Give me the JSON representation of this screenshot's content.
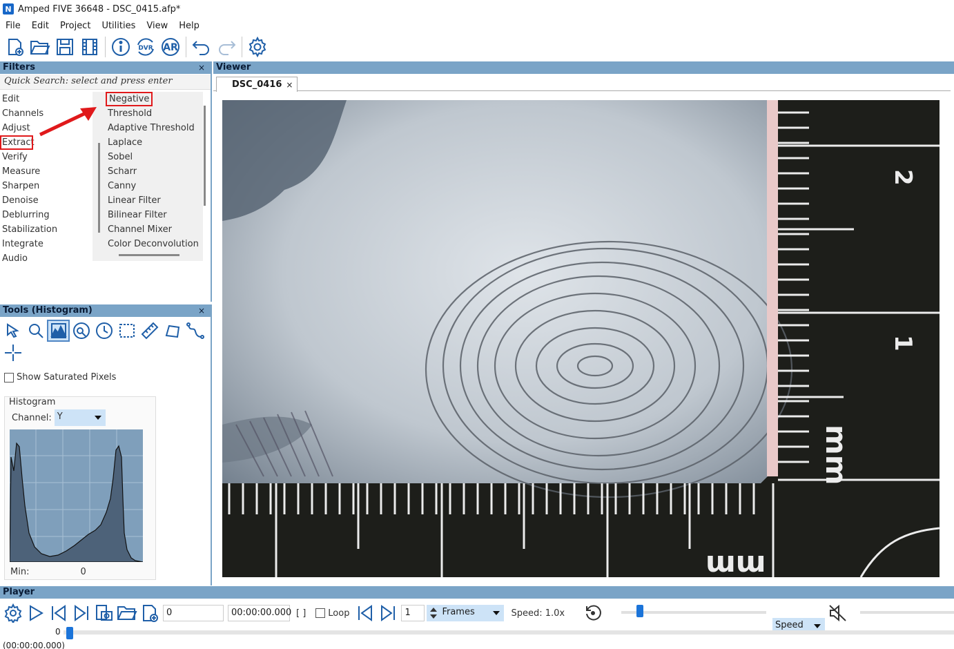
{
  "window": {
    "title": "Amped FIVE 36648 - DSC_0415.afp*",
    "app_icon_text": "N"
  },
  "menu": [
    "File",
    "Edit",
    "Project",
    "Utilities",
    "View",
    "Help"
  ],
  "toolbar": {
    "icons": [
      "new-project-icon",
      "open-folder-icon",
      "save-icon",
      "film-icon",
      "info-icon",
      "dvr-icon",
      "ar-icon",
      "undo-icon",
      "redo-icon",
      "settings-gear-icon"
    ],
    "dvr_text": "DVR",
    "ar_text": "AR"
  },
  "filters": {
    "title": "Filters",
    "close": "×",
    "search_placeholder": "Quick Search: select and press enter",
    "categories": [
      "Edit",
      "Channels",
      "Adjust",
      "Extract",
      "Verify",
      "Measure",
      "Sharpen",
      "Denoise",
      "Deblurring",
      "Stabilization",
      "Integrate",
      "Audio"
    ],
    "selected_category": "Extract",
    "items": [
      "Negative",
      "Threshold",
      "Adaptive Threshold",
      "Laplace",
      "Sobel",
      "Scharr",
      "Canny",
      "Linear Filter",
      "Bilinear Filter",
      "Channel Mixer",
      "Color Deconvolution"
    ],
    "selected_item": "Negative"
  },
  "tools": {
    "title": "Tools (Histogram)",
    "close": "×",
    "icons": [
      "select-arrow-icon",
      "zoom-icon",
      "histogram-icon",
      "magnifier-circle-icon",
      "clock-icon",
      "rectangle-select-icon",
      "ruler-icon",
      "polygon-icon",
      "curve-icon",
      "crosshair-icon"
    ],
    "show_saturated_label": "Show Saturated Pixels",
    "histogram_label": "Histogram",
    "channel_label": "Channel:",
    "channel_value": "Y",
    "min_label": "Min:",
    "min_value": "0"
  },
  "viewer": {
    "title": "Viewer",
    "tab_label": "DSC_0416",
    "tab_close": "×",
    "ruler_right_labels": [
      "2",
      "1",
      "mm"
    ],
    "ruler_bottom_label": "mm"
  },
  "player": {
    "title": "Player",
    "frame_field": "0",
    "time_field": "00:00:00.000",
    "brackets": "[ ]",
    "loop_label": "Loop",
    "step_field": "1",
    "unit_select": "Frames",
    "speed_label": "Speed: 1.0x",
    "speed_select": "Speed",
    "seek_frame": "0",
    "seek_time": "(00:00:00.000)"
  },
  "colors": {
    "panel_header": "#7aa4c7",
    "accent": "#1f5fa8",
    "highlight_red": "#e0191b",
    "selected_bg": "#cde3f7"
  }
}
